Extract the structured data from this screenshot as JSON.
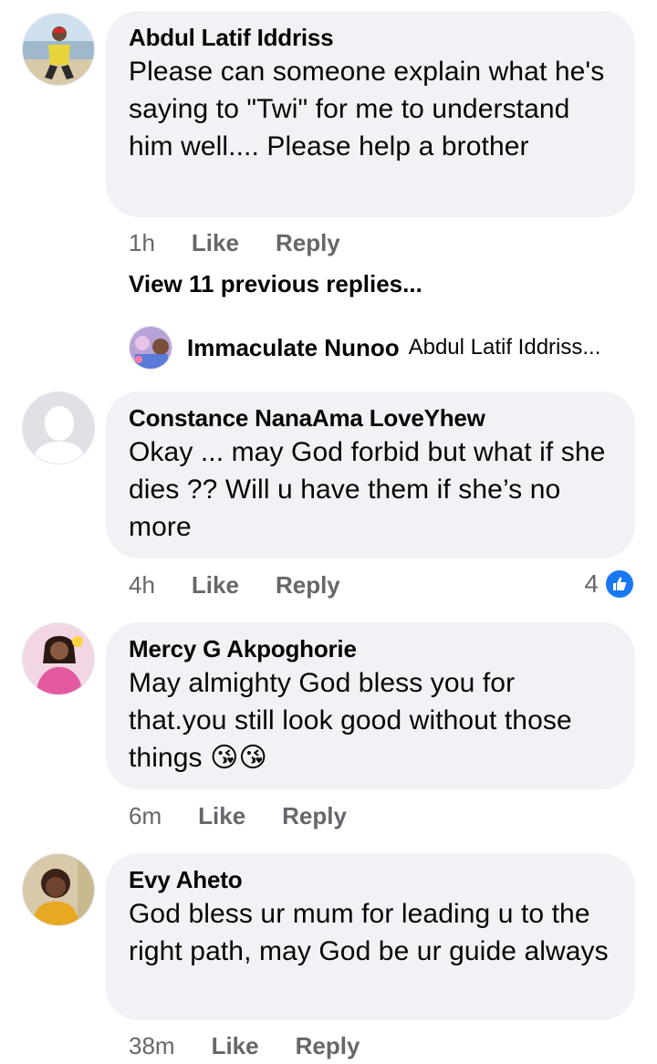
{
  "comments": [
    {
      "author": "Abdul Latif Iddriss",
      "text": "Please can someone explain what he's saying to \"Twi\" for me to understand him well.... Please help a brother",
      "time": "1h",
      "like": "Like",
      "reply": "Reply"
    },
    {
      "author": "Constance NanaAma LoveYhew",
      "text": "Okay ... may God forbid but what if she dies ?? Will u have them if she’s no more",
      "time": "4h",
      "like": "Like",
      "reply": "Reply",
      "reaction_count": "4"
    },
    {
      "author": "Mercy G Akpoghorie",
      "text": "May almighty God bless you for that.you still look good without those things 😘😘",
      "time": "6m",
      "like": "Like",
      "reply": "Reply"
    },
    {
      "author": "Evy Aheto",
      "text": "God bless ur mum for leading u to the right path, may God be ur guide always",
      "time": "38m",
      "like": "Like",
      "reply": "Reply"
    }
  ],
  "view_previous": "View 11 previous replies...",
  "latest_reply": {
    "author": "Immaculate Nunoo",
    "snippet": "Abdul Latif Iddriss..."
  },
  "colors": {
    "bubble": "#f0f2f5",
    "meta": "#65676b",
    "like_blue": "#1877f2"
  }
}
